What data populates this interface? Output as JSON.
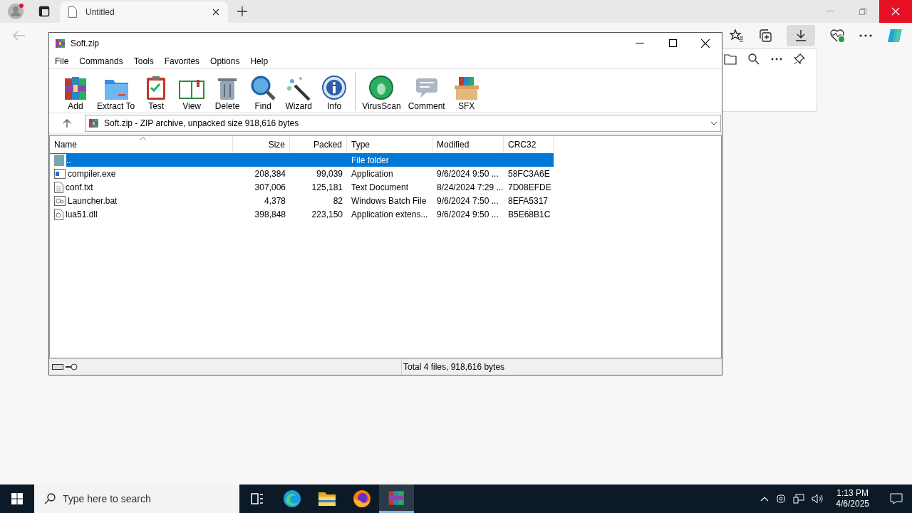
{
  "browser": {
    "tabs": [
      {
        "title": "Untitled",
        "selected": true
      }
    ],
    "downloads_selected": true
  },
  "window": {
    "title": "Soft.zip",
    "menu": [
      "File",
      "Commands",
      "Tools",
      "Favorites",
      "Options",
      "Help"
    ],
    "toolbar": [
      [
        "Add",
        "Extract To",
        "Test",
        "View",
        "Delete",
        "Find",
        "Wizard",
        "Info"
      ],
      [
        "VirusScan",
        "Comment",
        "SFX"
      ]
    ],
    "address": "Soft.zip - ZIP archive, unpacked size 918,616 bytes",
    "columns": [
      "Name",
      "Size",
      "Packed",
      "Type",
      "Modified",
      "CRC32"
    ],
    "rows": [
      {
        "kind": "folder",
        "name": "..",
        "size": "",
        "packed": "",
        "type": "File folder",
        "modified": "",
        "crc": "",
        "selected": true
      },
      {
        "kind": "exe",
        "name": "compiler.exe",
        "size": "208,384",
        "packed": "99,039",
        "type": "Application",
        "modified": "9/6/2024 9:50 ...",
        "crc": "58FC3A6E",
        "selected": false
      },
      {
        "kind": "txt",
        "name": "conf.txt",
        "size": "307,006",
        "packed": "125,181",
        "type": "Text Document",
        "modified": "8/24/2024 7:29 ...",
        "crc": "7D08EFDE",
        "selected": false
      },
      {
        "kind": "bat",
        "name": "Launcher.bat",
        "size": "4,378",
        "packed": "82",
        "type": "Windows Batch File",
        "modified": "9/6/2024 7:50 ...",
        "crc": "8EFA5317",
        "selected": false
      },
      {
        "kind": "dll",
        "name": "lua51.dll",
        "size": "398,848",
        "packed": "223,150",
        "type": "Application extens...",
        "modified": "9/6/2024 9:50 ...",
        "crc": "B5E68B1C",
        "selected": false
      }
    ],
    "status": "Total 4 files, 918,616 bytes"
  },
  "taskbar": {
    "search_placeholder": "Type here to search",
    "apps": [
      {
        "kind": "taskview",
        "selected": false
      },
      {
        "kind": "edge",
        "selected": false
      },
      {
        "kind": "explorer",
        "selected": false
      },
      {
        "kind": "firefox",
        "selected": false
      },
      {
        "kind": "winrar",
        "selected": true
      }
    ],
    "time": "1:13 PM",
    "date": "4/6/2025"
  }
}
